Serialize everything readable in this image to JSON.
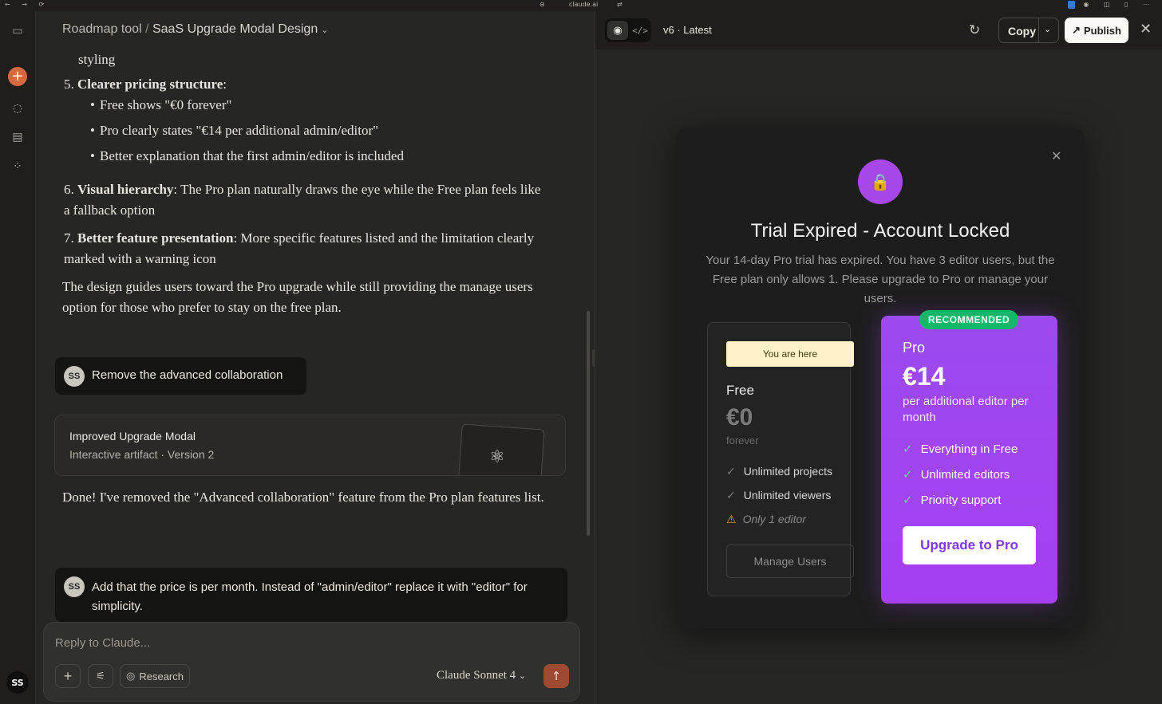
{
  "browser": {
    "url_label": "claude.ai"
  },
  "chat": {
    "breadcrumb_project": "Roadmap tool",
    "breadcrumb_sep": "/",
    "title": "SaaS Upgrade Modal Design",
    "partial_line": "styling",
    "items": [
      {
        "num": "5.",
        "bold": "Clearer pricing structure",
        "rest": ":"
      },
      {
        "num": "6.",
        "bold": "Visual hierarchy",
        "rest": ": The Pro plan naturally draws the eye while the Free plan feels like a fallback option"
      },
      {
        "num": "7.",
        "bold": "Better feature presentation",
        "rest": ": More specific features listed and the limitation clearly marked with a warning icon"
      }
    ],
    "bullets": [
      "Free shows \"€0 forever\"",
      "Pro clearly states \"€14 per additional admin/editor\"",
      "Better explanation that the first admin/editor is included"
    ],
    "summary": "The design guides users toward the Pro upgrade while still providing the manage users option for those who prefer to stay on the free plan.",
    "user_initials": "SS",
    "user_msg_1": "Remove the advanced collaboration",
    "artifact_title": "Improved Upgrade Modal",
    "artifact_subtitle": "Interactive artifact · Version 2",
    "reply": "Done! I've removed the \"Advanced collaboration\" feature from the Pro plan features list.",
    "user_msg_2": "Add that the price is per month. Instead of \"admin/editor\" replace it with \"editor\" for simplicity.",
    "composer_placeholder": "Reply to Claude...",
    "research_label": "Research",
    "model_label": "Claude Sonnet 4"
  },
  "rail": {
    "avatar": "SS"
  },
  "artifact": {
    "version_label": "v6 · Latest",
    "copy_label": "Copy",
    "publish_label": "Publish",
    "modal": {
      "title": "Trial Expired - Account Locked",
      "description": "Your 14-day Pro trial has expired. You have 3 editor users, but the Free plan only allows 1. Please upgrade to Pro or manage your users.",
      "free": {
        "badge": "You are here",
        "name": "Free",
        "price": "€0",
        "period": "forever",
        "features": [
          "Unlimited projects",
          "Unlimited viewers"
        ],
        "limitation": "Only 1 editor",
        "button": "Manage Users"
      },
      "pro": {
        "badge": "RECOMMENDED",
        "name": "Pro",
        "price": "€14",
        "period": "per additional editor per month",
        "features": [
          "Everything in Free",
          "Unlimited editors",
          "Priority support"
        ],
        "button": "Upgrade to Pro"
      }
    }
  },
  "colors": {
    "accent_orange": "#d56a3f",
    "pro_purple": "#a53ff0",
    "recommended_green": "#12b76a",
    "you_are_here_yellow": "#fcf1c7"
  }
}
